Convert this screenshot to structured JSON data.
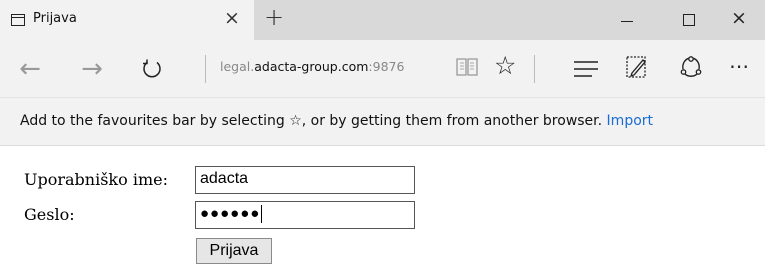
{
  "tab": {
    "title": "Prijava",
    "close": "×",
    "new_tab": "+"
  },
  "window_controls": {
    "minimize": "minimize-icon",
    "maximize": "maximize-icon",
    "close": "×"
  },
  "nav": {
    "back": "←",
    "forward": "→",
    "url_prefix": "legal.",
    "url_host": "adacta-group.com",
    "url_port": ":9876",
    "favourite_star": "☆",
    "more": "⋯"
  },
  "favourites_bar": {
    "message": "Add to the favourites bar by selecting ☆, or by getting them from another browser.",
    "link": "Import"
  },
  "login": {
    "username_label": "Uporabniško ime:",
    "username_value": "adacta",
    "password_label": "Geslo:",
    "password_value": "●●●●●●",
    "submit_label": "Prijava"
  },
  "colors": {
    "link": "#1a6cd1",
    "chrome": "#f2f2f2",
    "titlebar": "#d9d9d9"
  }
}
